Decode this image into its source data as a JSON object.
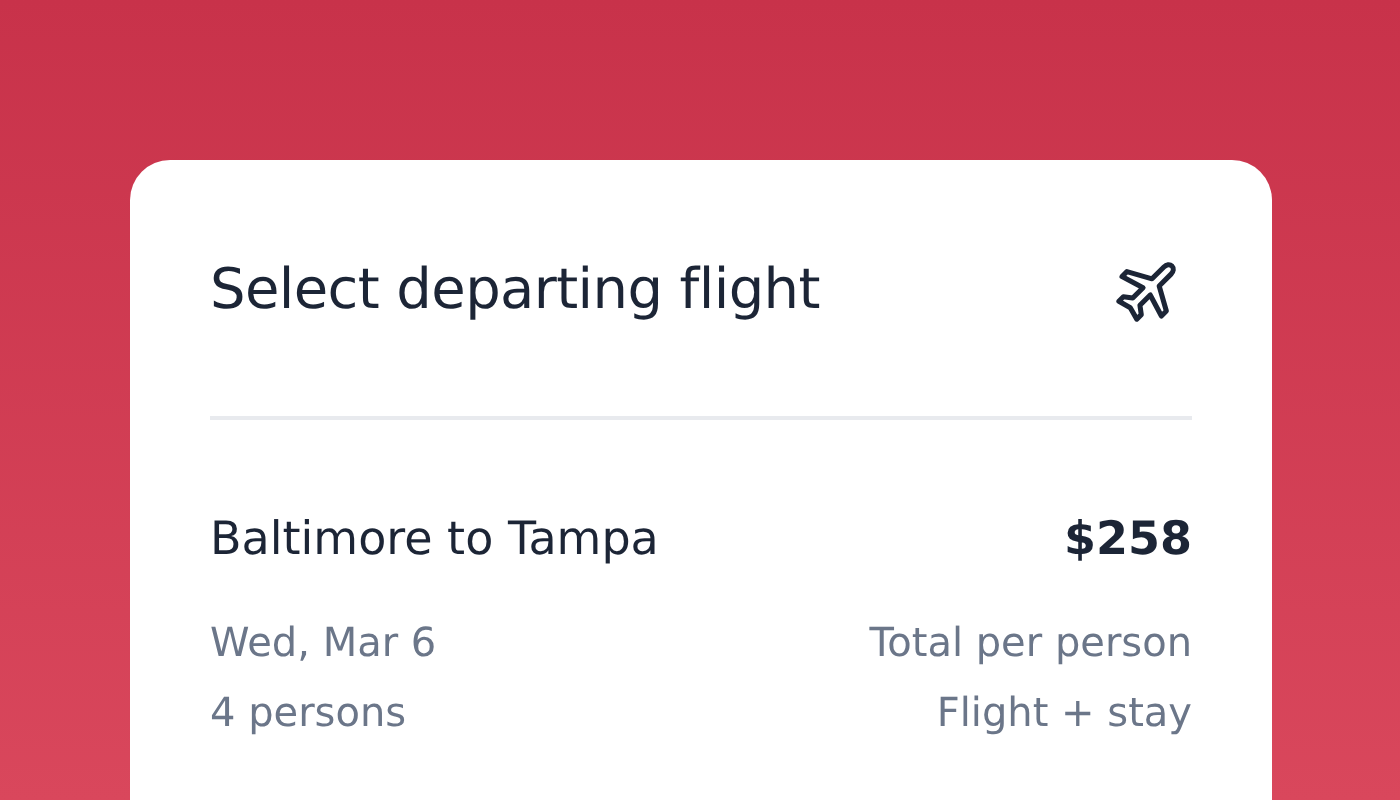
{
  "card": {
    "title": "Select departing flight",
    "flight": {
      "route": "Baltimore to Tampa",
      "price": "$258",
      "date": "Wed, Mar 6",
      "persons": "4 persons",
      "price_note": "Total per person",
      "package": "Flight + stay"
    }
  }
}
